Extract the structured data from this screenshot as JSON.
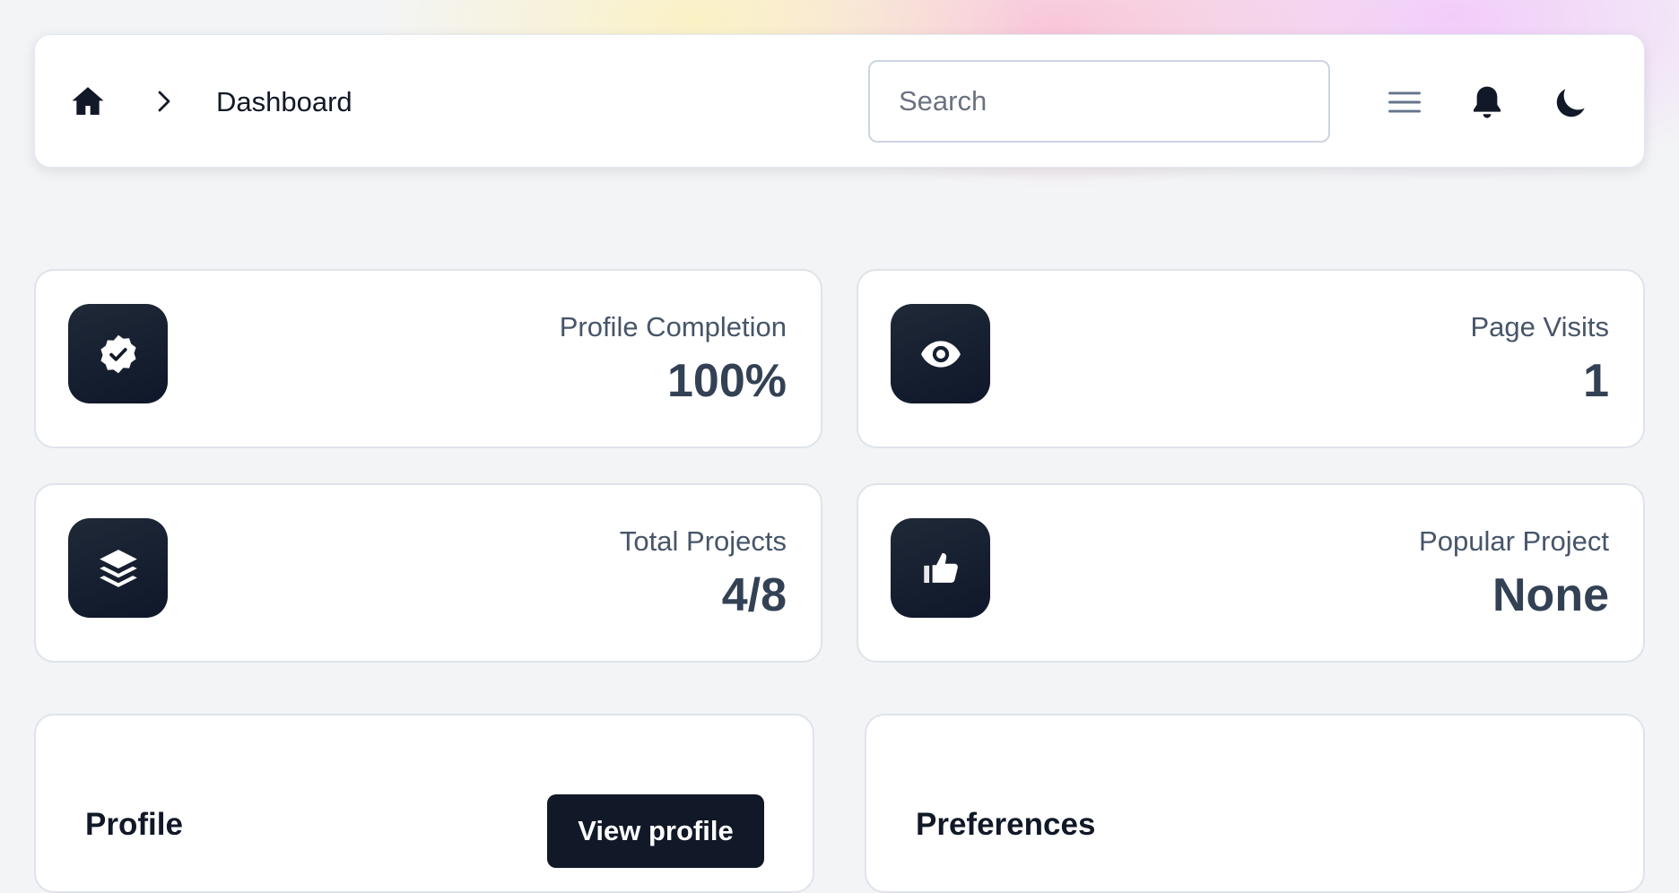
{
  "header": {
    "breadcrumb_current": "Dashboard",
    "search_placeholder": "Search",
    "icons": [
      "home-icon",
      "chevron-right-icon",
      "menu-icon",
      "bell-icon",
      "moon-icon"
    ]
  },
  "stats": [
    {
      "label": "Profile Completion",
      "value": "100%",
      "icon": "badge-check-icon"
    },
    {
      "label": "Page Visits",
      "value": "1",
      "icon": "eye-icon"
    },
    {
      "label": "Total Projects",
      "value": "4/8",
      "icon": "layers-icon"
    },
    {
      "label": "Popular Project",
      "value": "None",
      "icon": "thumbs-up-icon"
    }
  ],
  "panels": {
    "profile": {
      "title": "Profile",
      "button_label": "View profile"
    },
    "preferences": {
      "title": "Preferences"
    }
  },
  "colors": {
    "accent_dark": "#111827",
    "background": "#f3f4f6",
    "card": "#ffffff"
  }
}
